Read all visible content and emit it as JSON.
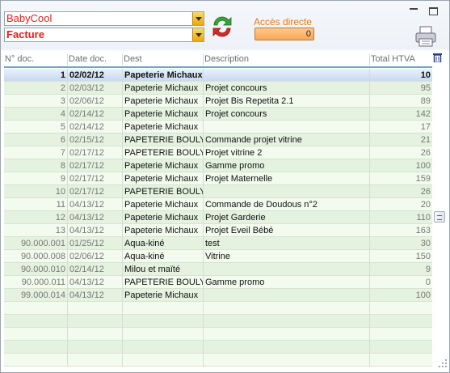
{
  "company_select": {
    "value": "BabyCool"
  },
  "doc_type_select": {
    "value": "Facture"
  },
  "acces_directe": {
    "label": "Accès directe",
    "value": "0"
  },
  "colors": {
    "accent_red": "#e32020",
    "accent_orange": "#f07800",
    "row_green": "#e4f2df"
  },
  "icons": [
    "refresh-icon",
    "printer-icon",
    "trash-icon",
    "minimize-icon",
    "maximize-icon"
  ],
  "table": {
    "headers": [
      "N° doc.",
      "Date doc.",
      "Dest",
      "Description",
      "Total HTVA"
    ],
    "rows": [
      [
        "1",
        "02/02/12",
        "Papeterie Michaux",
        "",
        "10"
      ],
      [
        "2",
        "02/03/12",
        "Papeterie Michaux",
        "Projet concours",
        "95"
      ],
      [
        "3",
        "02/06/12",
        "Papeterie Michaux",
        "Projet Bis Repetita 2.1",
        "89"
      ],
      [
        "4",
        "02/14/12",
        "Papeterie Michaux",
        "Projet concours",
        "142"
      ],
      [
        "5",
        "02/14/12",
        "Papeterie Michaux",
        "",
        "17"
      ],
      [
        "6",
        "02/15/12",
        "PAPETERIE BOULY",
        "Commande projet vitrine",
        "21"
      ],
      [
        "7",
        "02/17/12",
        "PAPETERIE BOULY",
        "Projet vitrine 2",
        "26"
      ],
      [
        "8",
        "02/17/12",
        "Papeterie Michaux",
        "Gamme promo",
        "100"
      ],
      [
        "9",
        "02/17/12",
        "Papeterie Michaux",
        "Projet Maternelle",
        "159"
      ],
      [
        "10",
        "02/17/12",
        "PAPETERIE BOULY",
        "",
        "26"
      ],
      [
        "11",
        "04/13/12",
        "Papeterie Michaux",
        "Commande de Doudous n°2",
        "20"
      ],
      [
        "12",
        "04/13/12",
        "Papeterie Michaux",
        "Projet Garderie",
        "110"
      ],
      [
        "13",
        "04/13/12",
        "Papeterie Michaux",
        "Projet Eveil Bébé",
        "163"
      ],
      [
        "90.000.001",
        "01/25/12",
        "Aqua-kiné",
        "test",
        "30"
      ],
      [
        "90.000.008",
        "02/06/12",
        "Aqua-kiné",
        "Vitrine",
        "150"
      ],
      [
        "90.000.010",
        "02/14/12",
        "Milou et maïté",
        "",
        "9"
      ],
      [
        "90.000.011",
        "04/13/12",
        "PAPETERIE BOULY",
        "Gamme promo",
        "0"
      ],
      [
        "99.000.014",
        "04/13/12",
        "Papeterie Michaux",
        "",
        "100"
      ]
    ],
    "selected_index": 0,
    "empty_rows": 5
  }
}
